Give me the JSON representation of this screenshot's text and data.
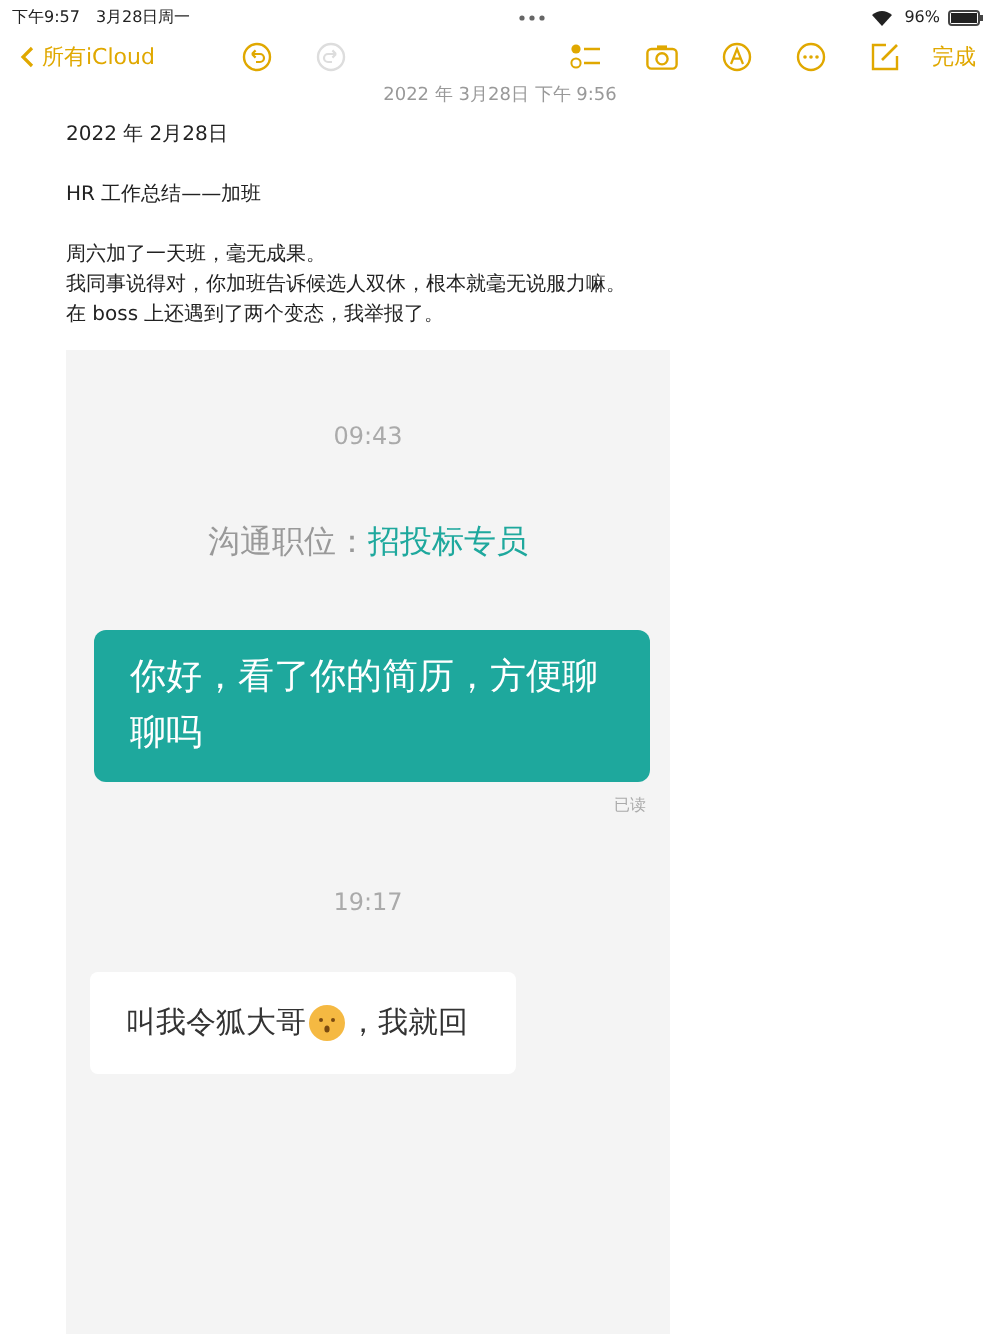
{
  "status_bar": {
    "time": "下午9:57",
    "date": "3月28日周一",
    "battery": "96%"
  },
  "toolbar": {
    "back": "所有iCloud",
    "done": "完成",
    "redo_disabled": true
  },
  "note": {
    "timestamp": "2022 年 3月28日 下午 9:56",
    "lines": [
      {
        "kind": "text",
        "text": "2022 年 2月28日"
      },
      {
        "kind": "blank"
      },
      {
        "kind": "text",
        "text": "HR 工作总结——加班"
      },
      {
        "kind": "blank"
      },
      {
        "kind": "text",
        "text": "周六加了一天班，毫无成果。"
      },
      {
        "kind": "text",
        "text": "我同事说得对，你加班告诉候选人双休，根本就毫无说服力嘛。"
      },
      {
        "kind": "text",
        "text": "在 boss 上还遇到了两个变态，我举报了。"
      }
    ]
  },
  "chat": {
    "messages": [
      {
        "kind": "time",
        "text": "09:43"
      },
      {
        "kind": "position",
        "label": "沟通职位：",
        "value": "招投标专员"
      },
      {
        "kind": "sent",
        "text": "你好，看了你的简历，方便聊聊吗",
        "status": "已读"
      },
      {
        "kind": "time",
        "text": "19:17"
      },
      {
        "kind": "received",
        "text_before": "叫我令狐大哥",
        "text_after": "，我就回"
      }
    ]
  }
}
